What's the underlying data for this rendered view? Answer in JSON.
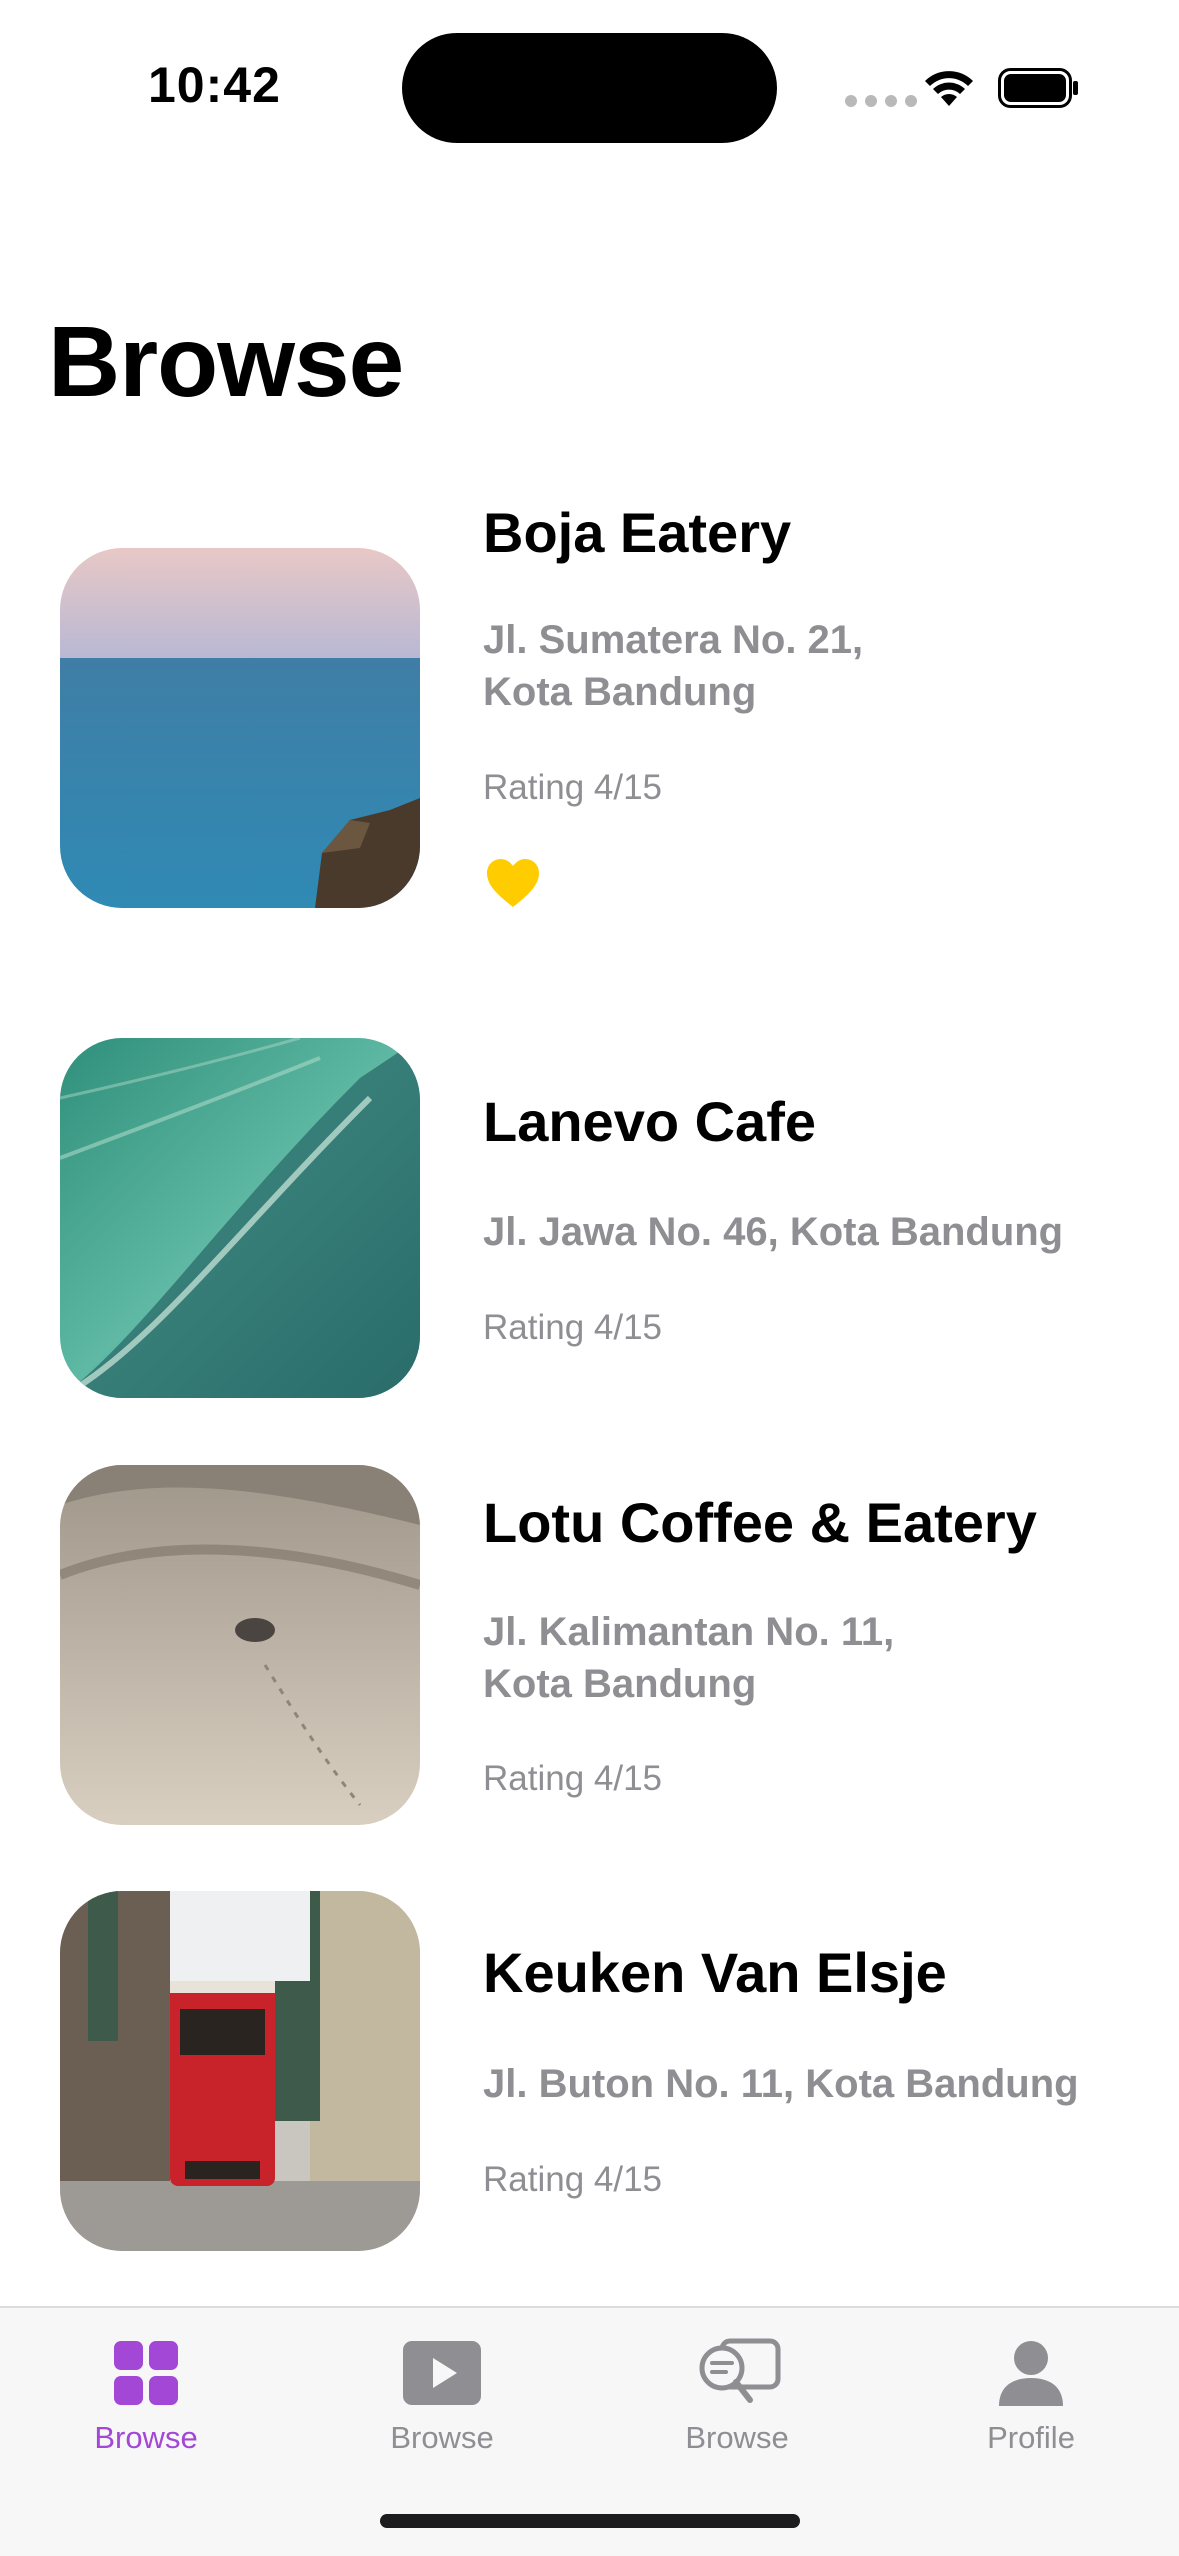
{
  "status_bar": {
    "time": "10:42"
  },
  "page": {
    "title": "Browse"
  },
  "places": [
    {
      "name": "Boja Eatery",
      "address": "Jl. Sumatera No. 21,\nKota Bandung",
      "rating": "Rating 4/15",
      "favorite": true,
      "image": "sea with rocky cliff"
    },
    {
      "name": "Lanevo Cafe",
      "address": "Jl. Jawa No. 46, Kota Bandung",
      "rating": "Rating 4/15",
      "favorite": false,
      "image": "ocean wave"
    },
    {
      "name": "Lotu Coffee & Eatery",
      "address": "Jl. Kalimantan No. 11,\nKota Bandung",
      "rating": "Rating 4/15",
      "favorite": false,
      "image": "desert dunes with vehicle"
    },
    {
      "name": "Keuken Van Elsje",
      "address": "Jl. Buton No. 11, Kota Bandung",
      "rating": "Rating 4/15",
      "favorite": false,
      "image": "red tram on city street"
    }
  ],
  "tabs": [
    {
      "label": "Browse",
      "icon": "grid-icon",
      "active": true
    },
    {
      "label": "Browse",
      "icon": "play-icon",
      "active": false
    },
    {
      "label": "Browse",
      "icon": "chat-search-icon",
      "active": false
    },
    {
      "label": "Profile",
      "icon": "person-icon",
      "active": false
    }
  ],
  "colors": {
    "accent": "#a347d6",
    "secondary_text": "#8e8e93",
    "favorite": "#ffcc00"
  }
}
